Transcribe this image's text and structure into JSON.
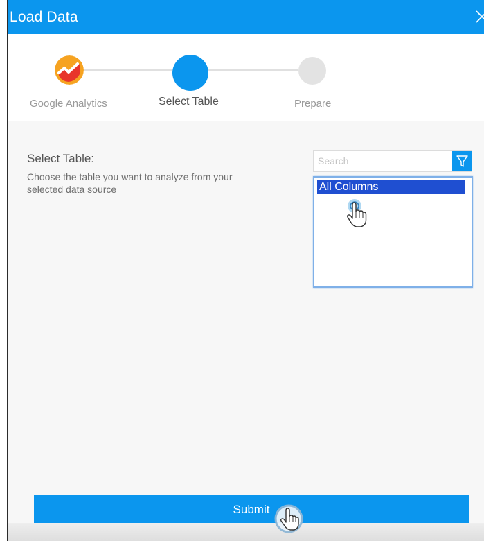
{
  "window": {
    "title": "Load Data"
  },
  "steps": [
    {
      "label": "Google Analytics",
      "state": "done",
      "icon": "google-analytics-icon"
    },
    {
      "label": "Select Table",
      "state": "active",
      "icon": ""
    },
    {
      "label": "Prepare",
      "state": "pending",
      "icon": ""
    }
  ],
  "section": {
    "title": "Select Table:",
    "description": "Choose the table you want to analyze from your selected data source"
  },
  "search": {
    "placeholder": "Search",
    "value": ""
  },
  "table_list": {
    "items": [
      {
        "label": "All Columns",
        "selected": true
      }
    ]
  },
  "footer": {
    "submit_label": "Submit"
  },
  "colors": {
    "accent": "#0b96ee",
    "selected_row": "#1f4fd1",
    "inactive_step": "#e0e0e0"
  }
}
